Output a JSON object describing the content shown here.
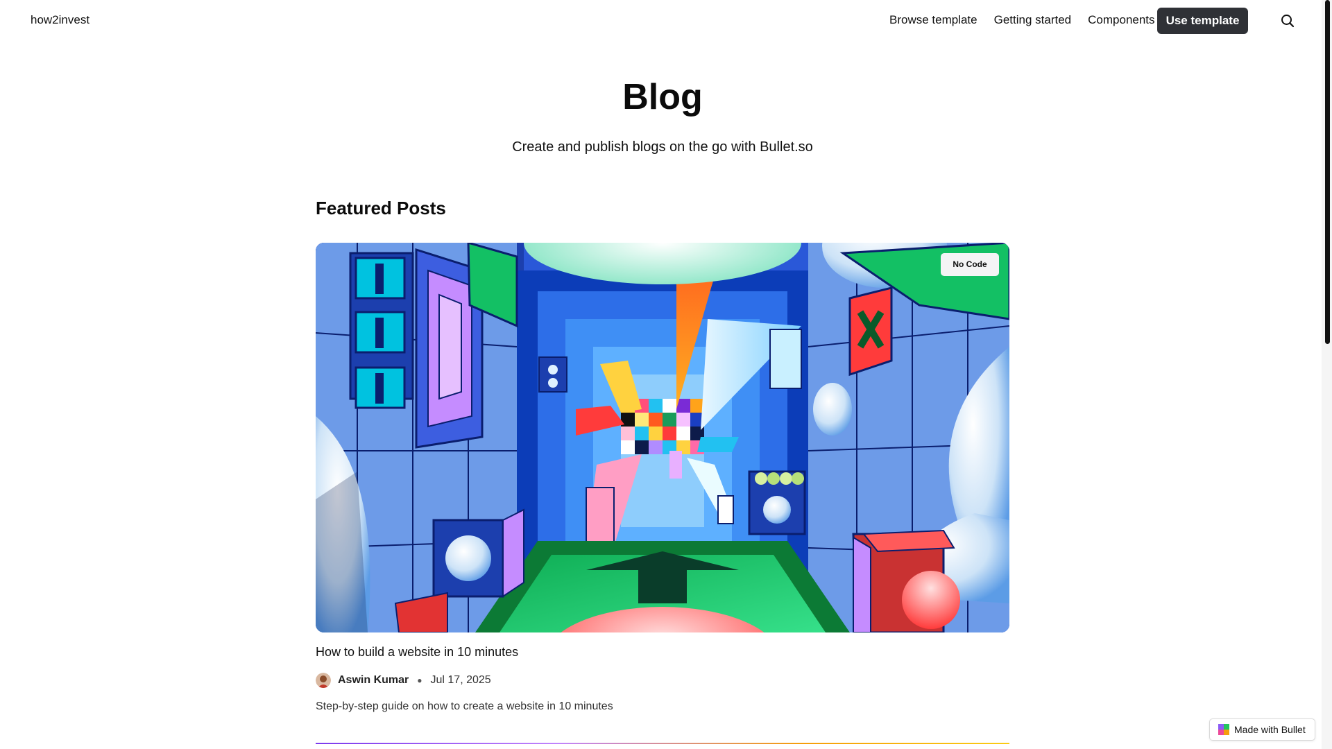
{
  "header": {
    "brand": "how2invest",
    "nav": [
      "Browse template",
      "Getting started",
      "Components"
    ],
    "cta": "Use template",
    "search_icon": "search-icon"
  },
  "hero": {
    "title": "Blog",
    "subtitle": "Create and publish blogs on the go with Bullet.so"
  },
  "featured": {
    "heading": "Featured Posts",
    "post": {
      "tag": "No Code",
      "title": "How to build a website in 10 minutes",
      "author": "Aswin Kumar",
      "date": "Jul 17, 2025",
      "excerpt": "Step-by-step guide on how to create a website in 10 minutes",
      "image_icon": "abstract-3d-corridor-illustration"
    }
  },
  "badge": {
    "label": "Made with Bullet",
    "logo_icon": "bullet-logo-icon"
  },
  "colors": {
    "cta_bg": "#2f3136",
    "divider_start": "#7c3aed",
    "divider_end": "#facc15"
  }
}
